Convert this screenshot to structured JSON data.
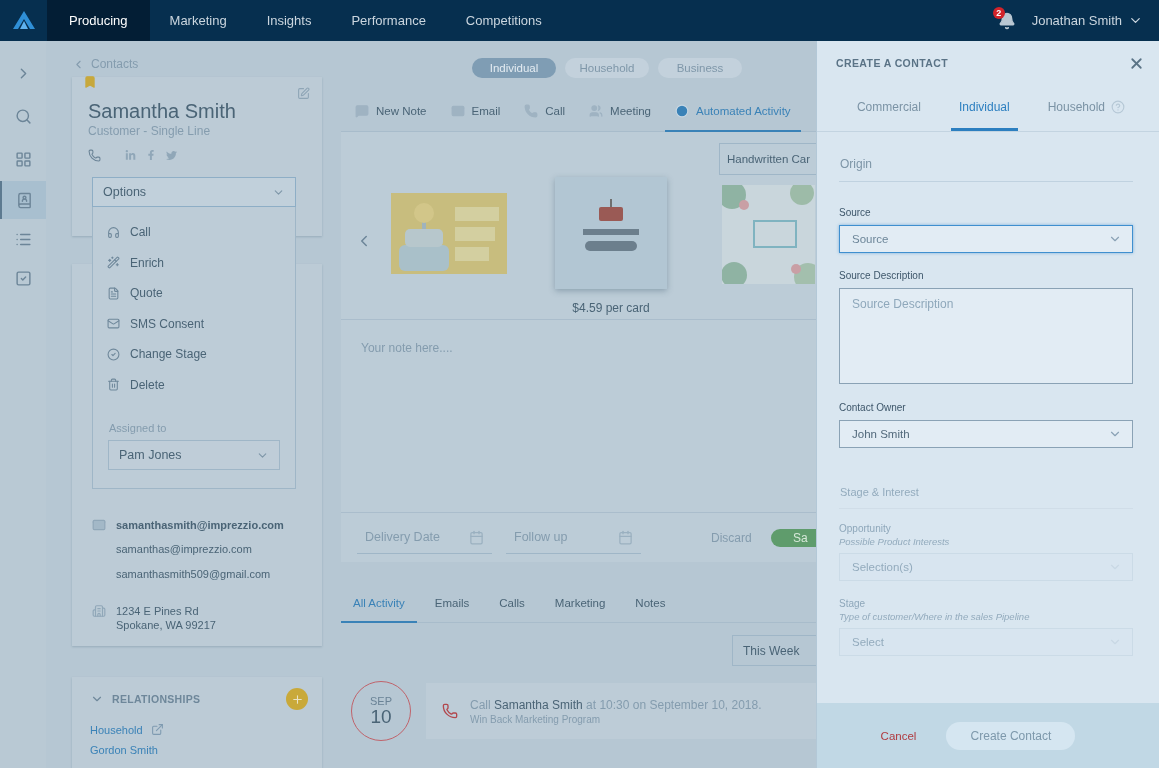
{
  "nav": {
    "tabs": [
      {
        "label": "Producing",
        "selected": true
      },
      {
        "label": "Marketing",
        "selected": false
      },
      {
        "label": "Insights",
        "selected": false
      },
      {
        "label": "Performance",
        "selected": false
      },
      {
        "label": "Competitions",
        "selected": false
      }
    ],
    "notifications": "2",
    "user": "Jonathan Smith"
  },
  "rail": {
    "items": [
      {
        "kind": "expand",
        "selected": false
      },
      {
        "kind": "search",
        "selected": false
      },
      {
        "kind": "dashboard",
        "selected": false
      },
      {
        "kind": "contacts",
        "selected": true
      },
      {
        "kind": "list",
        "selected": false
      },
      {
        "kind": "tasks",
        "selected": false
      }
    ]
  },
  "breadcrumb": "Contacts",
  "contact": {
    "name": "Samantha Smith",
    "subtitle": "Customer - Single Line",
    "options": {
      "label": "Options",
      "expanded": true,
      "items": [
        {
          "kind": "call",
          "label": "Call"
        },
        {
          "kind": "enrich",
          "label": "Enrich"
        },
        {
          "kind": "quote",
          "label": "Quote"
        },
        {
          "kind": "sms",
          "label": "SMS Consent"
        },
        {
          "kind": "stage",
          "label": "Change Stage"
        },
        {
          "kind": "delete",
          "label": "Delete"
        }
      ],
      "assigned_label": "Assigned to",
      "assigned_value": "Pam Jones"
    },
    "emails": [
      {
        "address": "samanthasmith@imprezzio.com",
        "primary": true
      },
      {
        "address": "samanthas@imprezzio.com",
        "primary": false
      },
      {
        "address": "samanthasmith509@gmail.com",
        "primary": false
      }
    ],
    "address": [
      "1234 E Pines Rd",
      "Spokane, WA 99217"
    ]
  },
  "relationships": {
    "title": "RELATIONSHIPS",
    "expanded": true,
    "links": [
      {
        "label": "Household",
        "external": true
      },
      {
        "label": "Gordon Smith",
        "external": false
      }
    ]
  },
  "contact_types": [
    {
      "label": "Individual",
      "selected": true
    },
    {
      "label": "Household",
      "selected": false
    },
    {
      "label": "Business",
      "selected": false
    }
  ],
  "composer": {
    "tabs": [
      {
        "kind": "note",
        "label": "New Note",
        "selected": false
      },
      {
        "kind": "email",
        "label": "Email",
        "selected": false
      },
      {
        "kind": "call",
        "label": "Call",
        "selected": false
      },
      {
        "kind": "meeting",
        "label": "Meeting",
        "selected": false
      },
      {
        "kind": "automated",
        "label": "Automated Activity",
        "selected": true
      }
    ],
    "template": "Handwritten Car",
    "cards": [
      {
        "kind": "picture",
        "selected": false
      },
      {
        "kind": "picture",
        "selected": true,
        "price": "$4.59 per card"
      },
      {
        "kind": "picture",
        "selected": false
      }
    ],
    "note_placeholder": "Your note here....",
    "delivery_placeholder": "Delivery Date",
    "follow_up_placeholder": "Follow up",
    "discard": "Discard",
    "save": "Sa"
  },
  "activity": {
    "tabs": [
      {
        "label": "All Activity",
        "selected": true
      },
      {
        "label": "Emails",
        "selected": false
      },
      {
        "label": "Calls",
        "selected": false
      },
      {
        "label": "Marketing",
        "selected": false
      },
      {
        "label": "Notes",
        "selected": false
      }
    ],
    "range": "This Week",
    "items": [
      {
        "kind": "call",
        "month": "SEP",
        "day": "10",
        "title": "Call **Samantha Smith** at 10:30 on September 10, 2018.",
        "subtitle": "Win Back Marketing Program"
      }
    ]
  },
  "panel": {
    "title": "CREATE A CONTACT",
    "tabs": [
      {
        "label": "Commercial",
        "selected": false,
        "help": false
      },
      {
        "label": "Individual",
        "selected": true,
        "help": false
      },
      {
        "label": "Household",
        "selected": false,
        "help": true
      }
    ],
    "sections": [
      {
        "title": "Origin",
        "disabled": false,
        "fields": [
          {
            "kind": "select",
            "label": "Source",
            "placeholder": "Source",
            "focused": true
          },
          {
            "kind": "textarea",
            "label": "Source Description",
            "placeholder": "Source Description",
            "focused": false
          },
          {
            "kind": "select",
            "label": "Contact Owner",
            "value": "John Smith",
            "focused": false
          }
        ]
      },
      {
        "title": "Stage & Interest",
        "disabled": true,
        "fields": [
          {
            "kind": "select",
            "label": "Opportunity",
            "hint": "Possible Product Interests",
            "placeholder": "Selection(s)",
            "focused": false
          },
          {
            "kind": "select",
            "label": "Stage",
            "hint": "Type of customer/Where in the sales Pipeline",
            "placeholder": "Select",
            "focused": false
          }
        ]
      }
    ],
    "cancel": "Cancel",
    "submit": {
      "label": "Create Contact",
      "disabled": true
    }
  }
}
